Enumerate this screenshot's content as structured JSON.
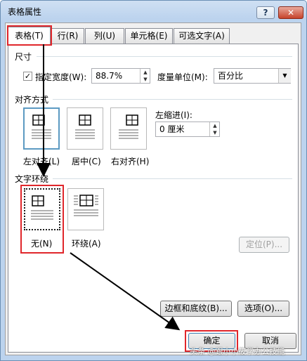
{
  "window": {
    "title": "表格属性",
    "help_label": "?",
    "close_label": "✕"
  },
  "tabs": [
    {
      "label": "表格(T)"
    },
    {
      "label": "行(R)"
    },
    {
      "label": "列(U)"
    },
    {
      "label": "单元格(E)"
    },
    {
      "label": "可选文字(A)"
    }
  ],
  "size": {
    "section_label": "尺寸",
    "preferred_width_label": "指定宽度(W):",
    "preferred_width_checked": true,
    "preferred_width_value": "88.7%",
    "measure_label": "度量单位(M):",
    "measure_value": "百分比"
  },
  "alignment": {
    "section_label": "对齐方式",
    "left_label": "左对齐(L)",
    "center_label": "居中(C)",
    "right_label": "右对齐(H)",
    "indent_label": "左缩进(I):",
    "indent_value": "0 厘米"
  },
  "wrapping": {
    "section_label": "文字环绕",
    "none_label": "无(N)",
    "around_label": "环绕(A)",
    "positioning_label": "定位(P)..."
  },
  "buttons": {
    "borders_label": "边框和底纹(B)...",
    "options_label": "选项(O)...",
    "ok_label": "确定",
    "cancel_label": "取消"
  },
  "watermark": "头条 @跟小小筱学办公技能"
}
